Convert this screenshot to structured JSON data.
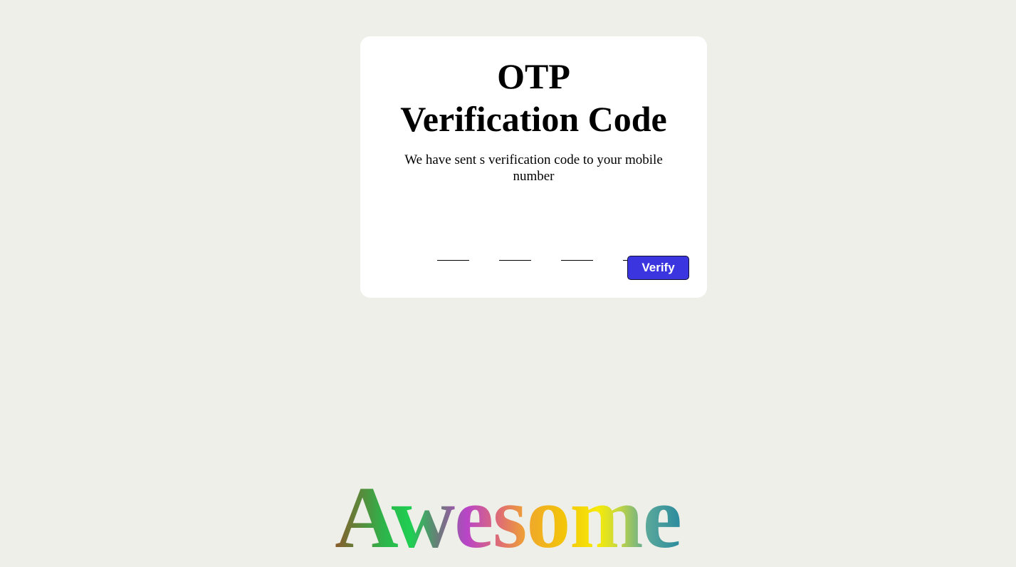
{
  "card": {
    "title_line1": "OTP",
    "title_line2": "Verification Code",
    "subtitle": "We have sent s verification code to your mobile number",
    "otp_inputs": [
      "",
      "",
      "",
      ""
    ],
    "verify_label": "Verify"
  },
  "banner": {
    "text": "Awesome"
  },
  "colors": {
    "background": "#efefe9",
    "card": "#ffffff",
    "button": "#3a35de"
  }
}
